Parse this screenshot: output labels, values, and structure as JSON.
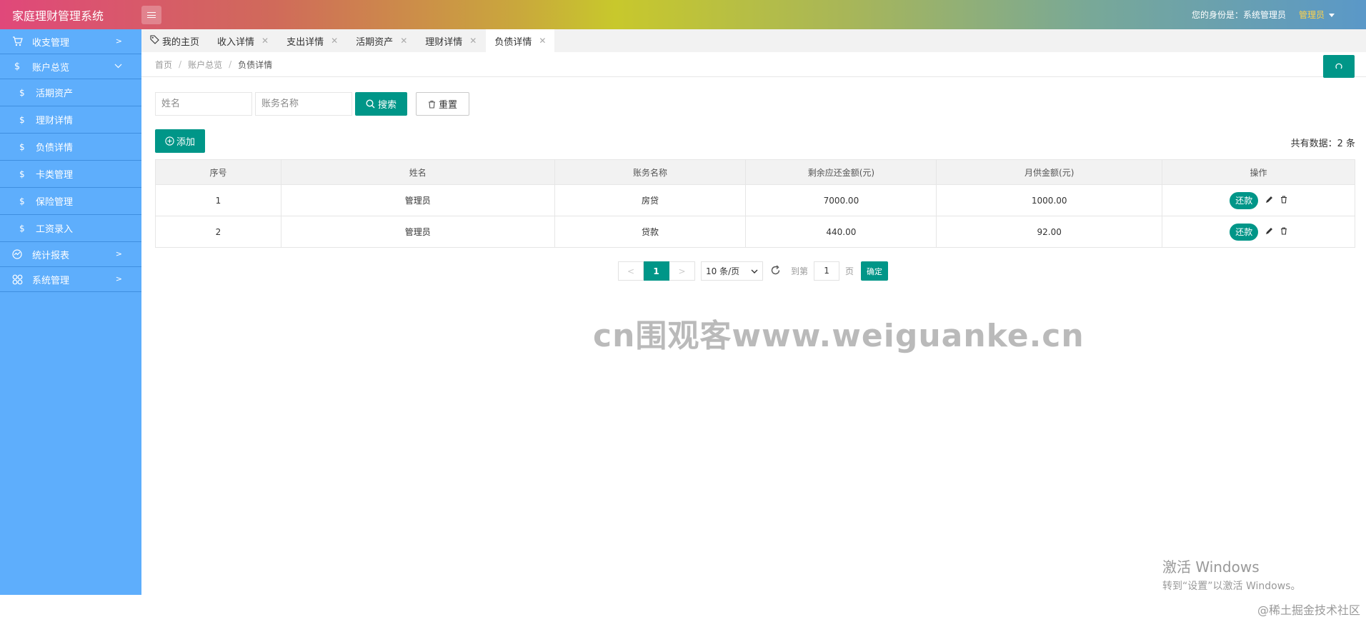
{
  "header": {
    "app_title": "家庭理财管理系统",
    "identity": "您的身份是：系统管理员",
    "user": "管理员"
  },
  "sidebar": {
    "items": [
      {
        "label": "收支管理",
        "icon": "cart-icon"
      },
      {
        "label": "账户总览",
        "icon": "dollar-icon"
      },
      {
        "label": "活期资产",
        "icon": "dollar-icon"
      },
      {
        "label": "理财详情",
        "icon": "dollar-icon"
      },
      {
        "label": "负债详情",
        "icon": "dollar-icon"
      },
      {
        "label": "卡类管理",
        "icon": "dollar-icon"
      },
      {
        "label": "保险管理",
        "icon": "dollar-icon"
      },
      {
        "label": "工资录入",
        "icon": "dollar-icon"
      },
      {
        "label": "统计报表",
        "icon": "chart-icon"
      },
      {
        "label": "系统管理",
        "icon": "apps-icon"
      }
    ]
  },
  "tabs": [
    {
      "label": "我的主页"
    },
    {
      "label": "收入详情"
    },
    {
      "label": "支出详情"
    },
    {
      "label": "活期资产"
    },
    {
      "label": "理财详情"
    },
    {
      "label": "负债详情"
    }
  ],
  "breadcrumb": [
    "首页",
    "账户总览",
    "负债详情"
  ],
  "breadcrumb_sep": "/",
  "search": {
    "name_placeholder": "姓名",
    "account_placeholder": "账务名称",
    "search_label": "搜索",
    "reset_label": "重置"
  },
  "add_label": "添加",
  "count_text": "共有数据：2 条",
  "table": {
    "headers": [
      "序号",
      "姓名",
      "账务名称",
      "剩余应还金额(元)",
      "月供金额(元)",
      "操作"
    ],
    "rows": [
      [
        "1",
        "管理员",
        "房贷",
        "7000.00",
        "1000.00"
      ],
      [
        "2",
        "管理员",
        "贷款",
        "440.00",
        "92.00"
      ]
    ],
    "repay_label": "还款"
  },
  "pager": {
    "prev": "<",
    "current": "1",
    "next": ">",
    "limit": "10 条/页",
    "goto_label": "到第",
    "goto_value": "1",
    "page_unit": "页",
    "confirm": "确定"
  },
  "watermark": "cn围观客www.weiguanke.cn",
  "activate": {
    "line1": "激活 Windows",
    "line2": "转到“设置”以激活 Windows。"
  },
  "footer_mark": "@稀土掘金技术社区",
  "colors": {
    "primary": "#009688",
    "sidebar": "#5eaefc",
    "user_highlight": "#ffd24a"
  }
}
